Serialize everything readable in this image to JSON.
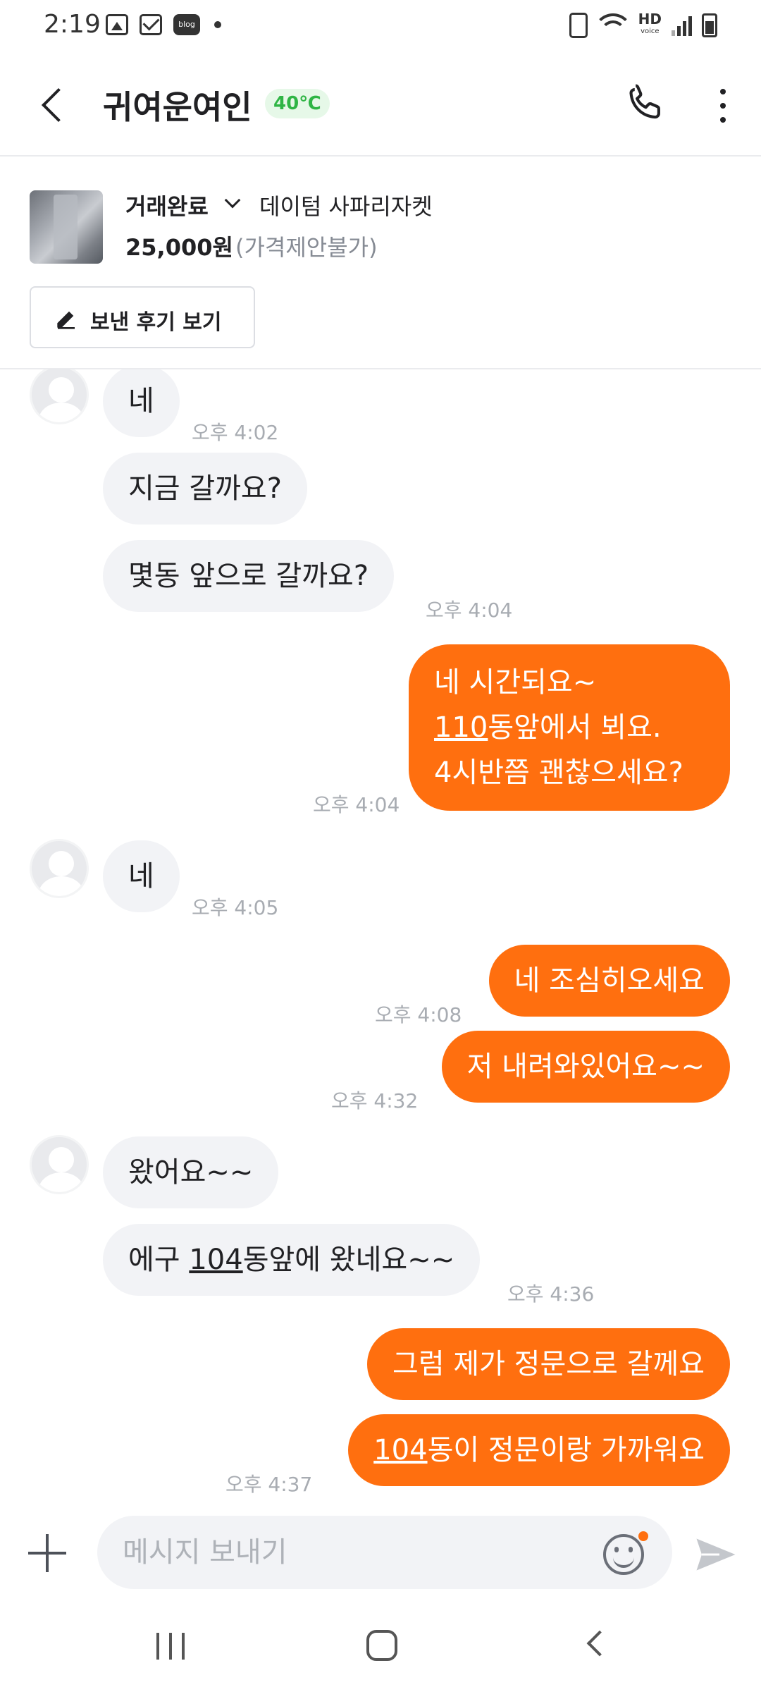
{
  "status_bar": {
    "time": "2:19",
    "blog_label": "blog",
    "hd_label": "HD",
    "hd_sub": "voice"
  },
  "header": {
    "title": "귀여운여인",
    "manner_temp": "40℃"
  },
  "product": {
    "status": "거래완료",
    "name": "데이텀 사파리자켓",
    "price": "25,000원",
    "negotiation": "(가격제안불가)",
    "review_button": "보낸 후기 보기"
  },
  "messages": [
    {
      "from": "them",
      "text": "네",
      "time": "오후 4:02"
    },
    {
      "from": "them",
      "text": "지금 갈까요?"
    },
    {
      "from": "them",
      "text": "몇동 앞으로 갈까요?",
      "time": "오후 4:04"
    },
    {
      "from": "me",
      "lines": [
        "네 시간되요~",
        "110동앞에서 뵈요.",
        "4시반쯤 괜찮으세요?"
      ],
      "link": "110",
      "time": "오후 4:04"
    },
    {
      "from": "them",
      "text": "네",
      "time": "오후 4:05"
    },
    {
      "from": "me",
      "text": "네 조심히오세요",
      "time": "오후 4:08"
    },
    {
      "from": "me",
      "text": "저 내려와있어요~~",
      "time": "오후 4:32"
    },
    {
      "from": "them",
      "text": "왔어요~~"
    },
    {
      "from": "them",
      "text_pre": "에구 ",
      "link": "104",
      "text_post": "동앞에 왔네요~~",
      "time": "오후 4:36"
    },
    {
      "from": "me",
      "text": "그럼 제가 정문으로 갈께요"
    },
    {
      "from": "me",
      "link": "104",
      "text_post": "동이 정문이랑 가까워요",
      "time": "오후 4:37"
    }
  ],
  "input": {
    "placeholder": "메시지 보내기"
  },
  "icons": {
    "back": "back-arrow-icon",
    "call": "phone-icon",
    "more": "more-vertical-icon",
    "attach": "plus-icon",
    "emoji": "emoji-icon",
    "send": "send-icon",
    "pencil": "pencil-icon"
  },
  "colors": {
    "accent": "#ff6f0f",
    "temp_text": "#2fb545",
    "temp_bg": "#e6f8e8",
    "incoming_bubble": "#f2f3f6"
  }
}
